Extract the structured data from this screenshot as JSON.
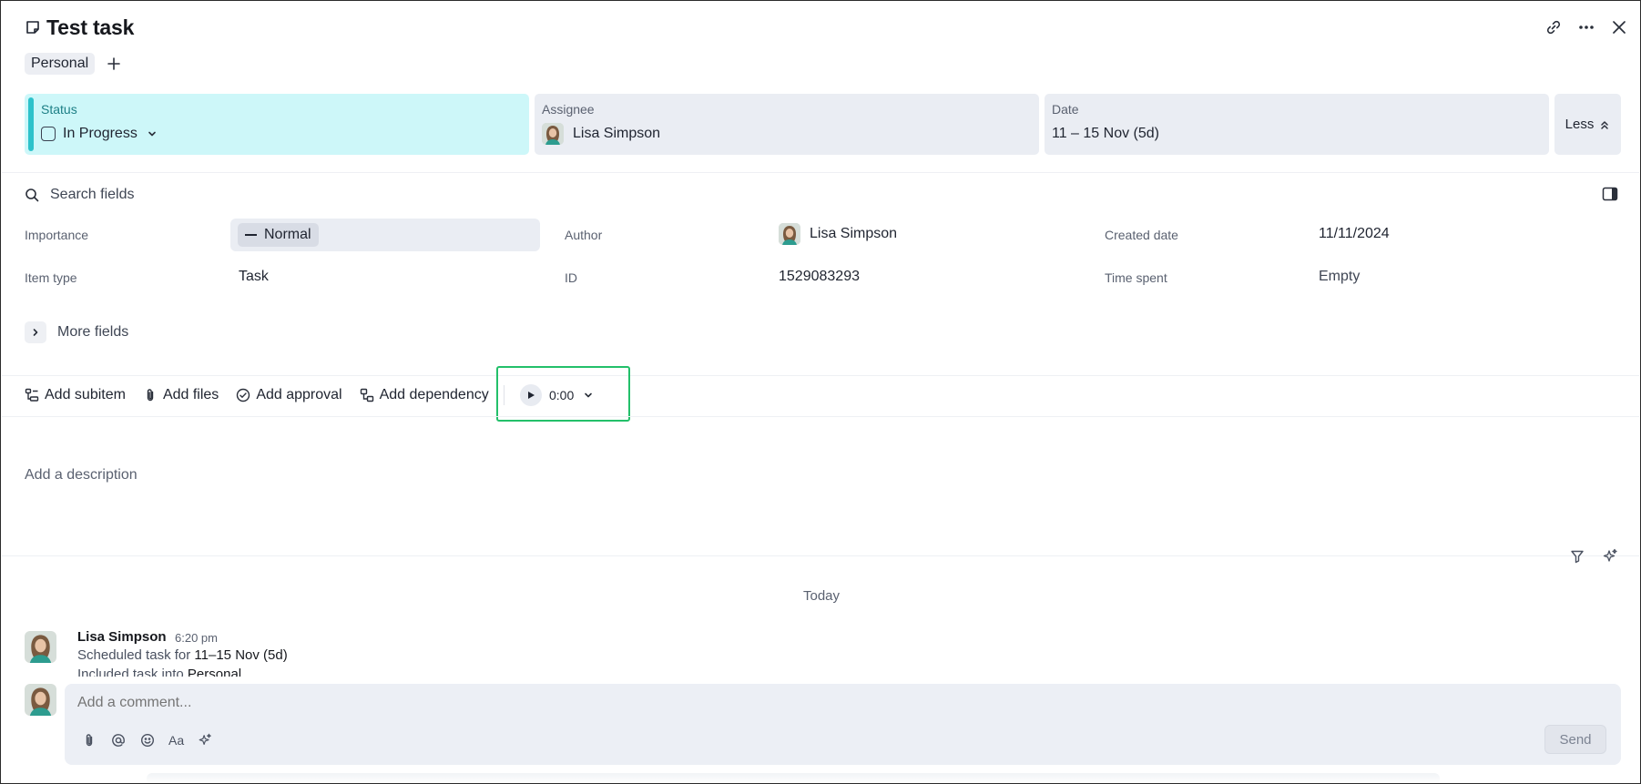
{
  "task": {
    "title": "Test task"
  },
  "tags": [
    "Personal"
  ],
  "top_fields": {
    "status": {
      "label": "Status",
      "value": "In Progress",
      "color": "#2dc2cb"
    },
    "assignee": {
      "label": "Assignee",
      "value": "Lisa Simpson"
    },
    "date": {
      "label": "Date",
      "value": "11 – 15 Nov (5d)"
    },
    "toggle_label": "Less"
  },
  "search": {
    "placeholder": "Search fields"
  },
  "fields": {
    "importance": {
      "label": "Importance",
      "value": "Normal"
    },
    "author": {
      "label": "Author",
      "value": "Lisa Simpson"
    },
    "created_date": {
      "label": "Created date",
      "value": "11/11/2024"
    },
    "item_type": {
      "label": "Item type",
      "value": "Task"
    },
    "id": {
      "label": "ID",
      "value": "1529083293"
    },
    "time_spent": {
      "label": "Time spent",
      "value": "Empty"
    }
  },
  "more_fields_label": "More fields",
  "toolbar": {
    "add_subitem": "Add subitem",
    "add_files": "Add files",
    "add_approval": "Add approval",
    "add_dependency": "Add dependency",
    "timer": "0:00"
  },
  "description": {
    "placeholder": "Add a description"
  },
  "activity": {
    "group_label": "Today",
    "entry": {
      "author": "Lisa Simpson",
      "time": "6:20 pm",
      "line1_prefix": "Scheduled task for",
      "line1_value": "11–15 Nov (5d)",
      "line2_prefix": "Included task into",
      "line2_value": "Personal"
    }
  },
  "comment": {
    "placeholder": "Add a comment...",
    "format_label": "Aa",
    "send_label": "Send"
  },
  "colors": {
    "accent_green": "#23c06a",
    "status_bg": "#cdf7f9"
  }
}
